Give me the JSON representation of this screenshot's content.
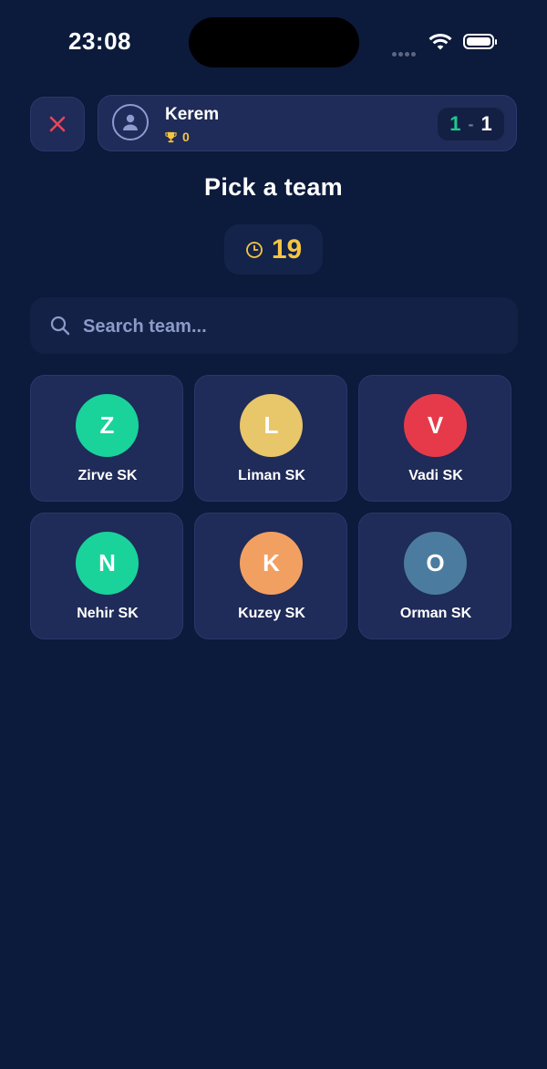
{
  "status_bar": {
    "time": "23:08",
    "icons": [
      "cellular-signal-icon",
      "wifi-icon",
      "battery-icon"
    ]
  },
  "header": {
    "close_icon": "close-icon",
    "player": {
      "name": "Kerem",
      "avatar_icon": "user-icon",
      "trophy_icon": "trophy-icon",
      "trophies": "0"
    },
    "score": {
      "left": "1",
      "separator": "-",
      "right": "1"
    }
  },
  "title": "Pick a team",
  "timer": {
    "icon": "clock-icon",
    "value": "19"
  },
  "search": {
    "icon": "search-icon",
    "placeholder": "Search team...",
    "value": ""
  },
  "teams": [
    {
      "initial": "Z",
      "name": "Zirve SK",
      "color": "#19d39a"
    },
    {
      "initial": "L",
      "name": "Liman SK",
      "color": "#e8c66a"
    },
    {
      "initial": "V",
      "name": "Vadi SK",
      "color": "#e63a4a"
    },
    {
      "initial": "N",
      "name": "Nehir SK",
      "color": "#19d39a"
    },
    {
      "initial": "K",
      "name": "Kuzey SK",
      "color": "#f2a062"
    },
    {
      "initial": "O",
      "name": "Orman SK",
      "color": "#4b7c9f"
    }
  ],
  "colors": {
    "background": "#0c1a3b",
    "card": "#1f2b58",
    "accent_yellow": "#f5c542",
    "accent_green": "#1ec98f",
    "close_red": "#e8455a"
  }
}
